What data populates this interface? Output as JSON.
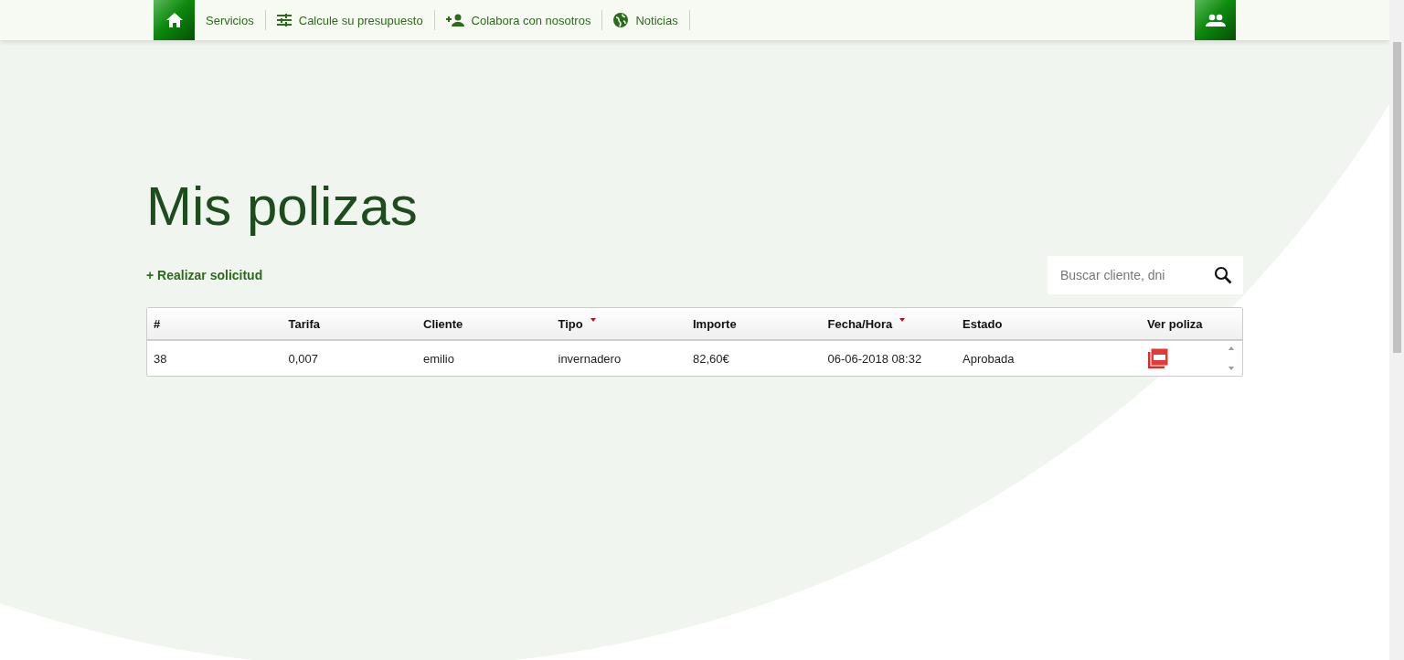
{
  "nav": {
    "items": [
      {
        "label": "Servicios",
        "kind": "plain"
      },
      {
        "label": "Calcule su presupuesto",
        "kind": "budget"
      },
      {
        "label": "Colabora con nosotros",
        "kind": "join"
      },
      {
        "label": "Noticias",
        "kind": "news"
      }
    ]
  },
  "page": {
    "title": "Mis polizas",
    "new_request_link": "+ Realizar solicitud",
    "search": {
      "placeholder": "Buscar cliente, dni"
    }
  },
  "table": {
    "columns": [
      {
        "label": "#",
        "sortable": false
      },
      {
        "label": "Tarifa",
        "sortable": false
      },
      {
        "label": "Cliente",
        "sortable": false
      },
      {
        "label": "Tipo",
        "sortable": true
      },
      {
        "label": "Importe",
        "sortable": false
      },
      {
        "label": "Fecha/Hora",
        "sortable": true
      },
      {
        "label": "Estado",
        "sortable": false
      },
      {
        "label": "Ver poliza",
        "sortable": false
      }
    ],
    "rows": [
      {
        "cells": [
          "38",
          "0,007",
          "emilio",
          "invernadero",
          "82,60€",
          "06-06-2018 08:32",
          "Aprobada"
        ],
        "pdf": true
      }
    ]
  }
}
